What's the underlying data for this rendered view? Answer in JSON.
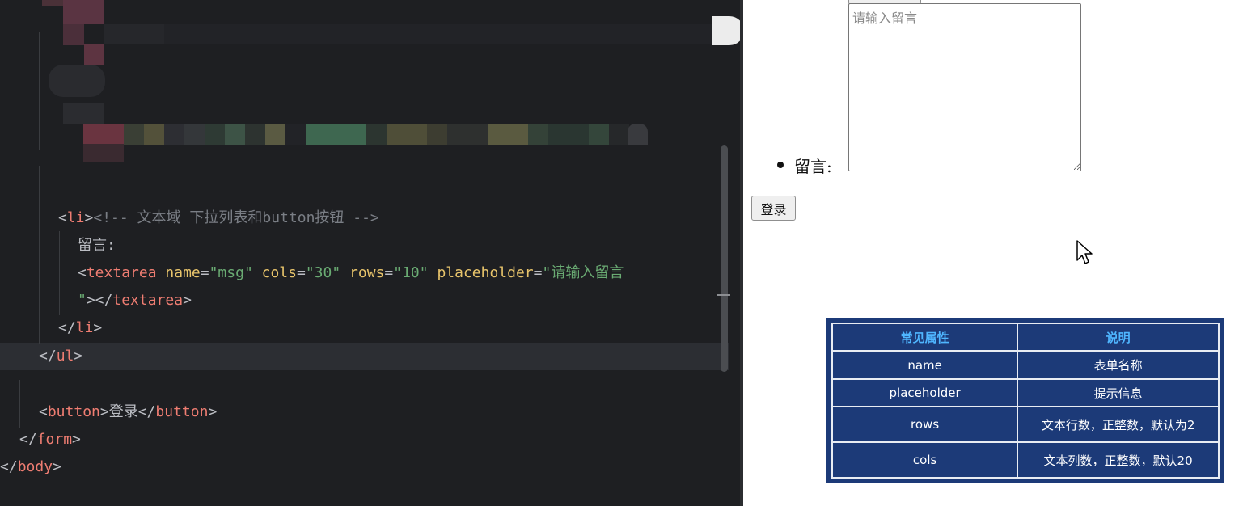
{
  "editor": {
    "comment_line": "<!-- 文本域 下拉列表和button按钮 -->",
    "li_open": "li",
    "label_text": "留言:",
    "textarea_tag": "textarea",
    "attr_name": "name",
    "attr_name_value": "\"msg\"",
    "attr_cols": "cols",
    "attr_cols_value": "\"30\"",
    "attr_rows": "rows",
    "attr_rows_value": "\"10\"",
    "attr_placeholder": "placeholder",
    "attr_placeholder_value_part1": "\"请输入留言",
    "attr_placeholder_value_part2": "\"",
    "textarea_close": "textarea",
    "li_close": "li",
    "ul_close": "ul",
    "button_tag": "button",
    "button_text": "登录",
    "form_close": "form",
    "body_close": "body"
  },
  "preview": {
    "message_label": "留言:",
    "textarea_placeholder": "请输入留言",
    "login_button": "登录"
  },
  "attr_table": {
    "header_attr": "常见属性",
    "header_desc": "说明",
    "rows": [
      {
        "attr": "name",
        "desc": "表单名称"
      },
      {
        "attr": "placeholder",
        "desc": "提示信息"
      },
      {
        "attr": "rows",
        "desc": "文本行数，正整数，默认为2"
      },
      {
        "attr": "cols",
        "desc": "文本列数，正整数，默认20"
      }
    ]
  },
  "colors": {
    "editor_bg": "#1e1f22",
    "tag": "#ef7d72",
    "attr": "#e8c46b",
    "string": "#6aab73",
    "comment": "#7a7e85",
    "table_bg": "#1c3a78",
    "table_header_text": "#4fb6ff"
  }
}
